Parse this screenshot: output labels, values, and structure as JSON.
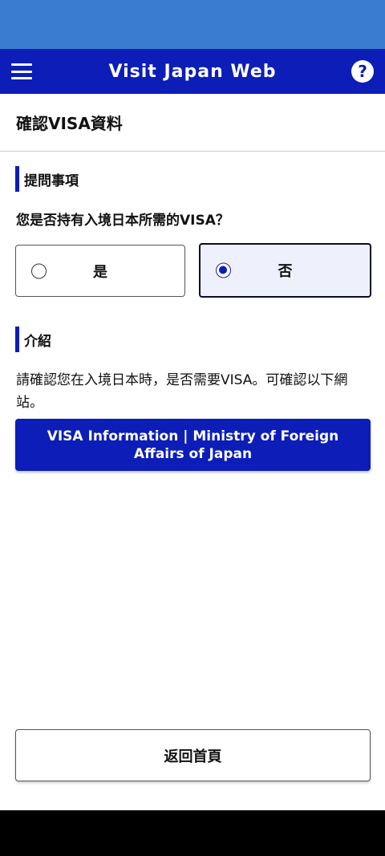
{
  "header": {
    "title": "Visit Japan Web",
    "help_symbol": "?",
    "color": "#0c1db8"
  },
  "page": {
    "title": "確認VISA資料"
  },
  "question_section": {
    "heading": "提問事項",
    "question": "您是否持有入境日本所需的VISA？",
    "options": [
      {
        "label": "是",
        "selected": false
      },
      {
        "label": "否",
        "selected": true
      }
    ]
  },
  "intro_section": {
    "heading": "介紹",
    "text": "請確認您在入境日本時，是否需要VISA。可確認以下網站。",
    "link_label": "VISA Information | Ministry of Foreign Affairs of Japan"
  },
  "footer": {
    "back_label": "返回首頁"
  },
  "colors": {
    "status_bar": "#3a7dd0",
    "primary": "#0c1db8"
  },
  "icons": {
    "menu": "hamburger-menu-icon",
    "help": "question-circle-icon"
  }
}
